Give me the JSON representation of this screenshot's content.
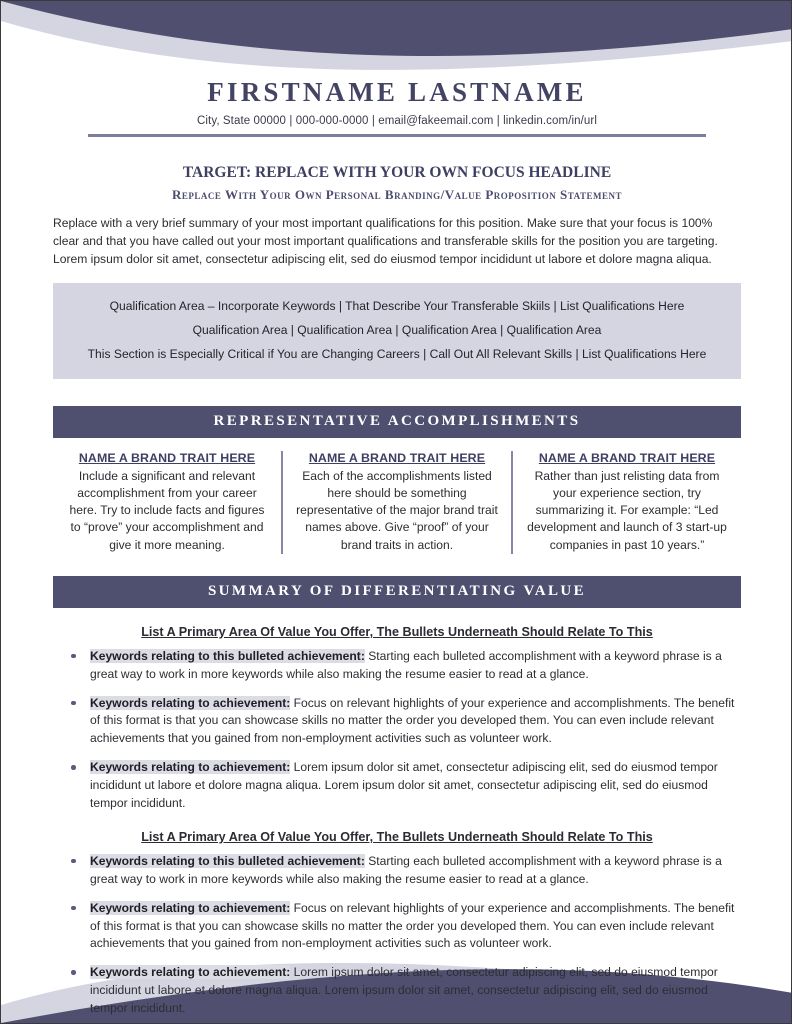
{
  "theme": {
    "accent_dark": "#4f4f70",
    "accent_light": "#d4d5e0",
    "text": "#2d2d33",
    "heading": "#3f3f63",
    "highlight": "#dcdce5"
  },
  "header": {
    "name": "FIRSTNAME LASTNAME",
    "contact": "City, State 00000  | 000-000-0000 | email@fakeemail.com | linkedin.com/in/url"
  },
  "target": {
    "headline": "TARGET: REPLACE WITH YOUR OWN FOCUS HEADLINE",
    "branding": "Replace With Your Own Personal Branding/Value Proposition Statement",
    "summary": "Replace with a very brief summary of your most important qualifications for this position. Make sure that your focus is 100% clear and that you have called out your most important qualifications and transferable skills for the position you are targeting. Lorem ipsum dolor sit amet, consectetur adipiscing elit, sed do eiusmod tempor incididunt ut labore et dolore magna aliqua."
  },
  "qualifications": {
    "lines": [
      "Qualification Area – Incorporate Keywords | That Describe Your Transferable Skiils | List Qualifications Here",
      "Qualification Area | Qualification Area | Qualification Area | Qualification Area",
      "This Section is Especially Critical if You are Changing Careers | Call Out All Relevant Skills | List Qualifications Here"
    ]
  },
  "accomplishments": {
    "section_title": "REPRESENTATIVE ACCOMPLISHMENTS",
    "columns": [
      {
        "title": "NAME A BRAND TRAIT HERE",
        "body": "Include a significant and relevant accomplishment from your career here. Try to include facts and figures to “prove” your accomplishment and give it more meaning."
      },
      {
        "title": "NAME A BRAND TRAIT HERE",
        "body": "Each of the accomplishments listed here should be something representative of the major brand trait names above. Give “proof” of your brand traits in action."
      },
      {
        "title": "NAME A BRAND TRAIT HERE",
        "body": "Rather than just relisting data from your experience section, try summarizing it. For example: “Led development and launch of 3 start-up companies in past 10 years.”"
      }
    ]
  },
  "value": {
    "section_title": "SUMMARY OF DIFFERENTIATING VALUE",
    "groups": [
      {
        "heading": "List A Primary Area Of Value You Offer, The Bullets Underneath Should Relate To This",
        "bullets": [
          {
            "lead": "Keywords relating to this bulleted achievement:",
            "text": " Starting each bulleted accomplishment with a keyword phrase is a great way to work in more keywords while also making the resume easier to read at a glance."
          },
          {
            "lead": "Keywords relating to achievement:",
            "text": " Focus on relevant highlights of your experience and accomplishments. The benefit of this format is that you can showcase skills no matter the order you developed them. You can even include relevant achievements that you gained from non-employment activities such as volunteer work."
          },
          {
            "lead": "Keywords relating to achievement:",
            "text": " Lorem ipsum dolor sit amet, consectetur adipiscing elit, sed do eiusmod tempor incididunt ut labore et dolore magna aliqua. Lorem ipsum dolor sit amet, consectetur adipiscing elit, sed do eiusmod tempor incididunt."
          }
        ]
      },
      {
        "heading": "List A Primary Area Of Value You Offer, The Bullets Underneath Should Relate To This",
        "bullets": [
          {
            "lead": "Keywords relating to this bulleted achievement:",
            "text": " Starting each bulleted accomplishment with a keyword phrase is a great way to work in more keywords while also making the resume easier to read at a glance."
          },
          {
            "lead": "Keywords relating to achievement:",
            "text": " Focus on relevant highlights of your experience and accomplishments. The benefit of this format is that you can showcase skills no matter the order you developed them. You can even include relevant achievements that you gained from non-employment activities such as volunteer work."
          },
          {
            "lead": "Keywords relating to achievement:",
            "text": " Lorem ipsum dolor sit amet, consectetur adipiscing elit, sed do eiusmod tempor incididunt ut labore et dolore magna aliqua. Lorem ipsum dolor sit amet, consectetur adipiscing elit, sed do eiusmod tempor incididunt."
          }
        ]
      }
    ]
  }
}
